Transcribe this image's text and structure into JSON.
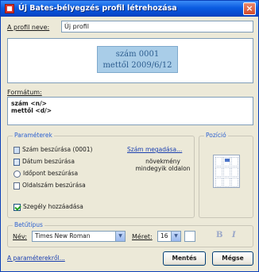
{
  "window": {
    "title": "Új Bates-bélyegzés profil létrehozása",
    "close_glyph": "×"
  },
  "profile": {
    "name_label": "A profil neve:",
    "name_value": "Új profil"
  },
  "preview": {
    "line1": "szám 0001",
    "line2": "mettől 2009/6/12",
    "color": "#a9cde8"
  },
  "format": {
    "label": "Formátum:",
    "lines": [
      "szám <n/>",
      "mettől <d/>"
    ]
  },
  "parameters": {
    "title": "Paraméterek",
    "items": [
      {
        "label": "Szám beszúrása (0001)",
        "icon": "number-icon"
      },
      {
        "label": "Dátum beszúrása",
        "icon": "calendar-icon"
      },
      {
        "label": "Időpont beszúrása",
        "icon": "clock-icon"
      },
      {
        "label": "Oldalszám beszúrása",
        "icon": "page-icon"
      }
    ],
    "number_spec_link": "Szám megadása...",
    "increment_note": [
      "növekmény",
      "mindegyik oldalon"
    ],
    "border_checkbox": {
      "label": "Szegély hozzáadása",
      "checked": true
    }
  },
  "position": {
    "title": "Pozíció"
  },
  "font": {
    "title": "Betűtípus",
    "name_label": "Név:",
    "name_value": "Times New Roman",
    "size_label": "Méret:",
    "size_value": "16",
    "bold_glyph": "B",
    "italic_glyph": "I"
  },
  "footer": {
    "about_link": "A paraméterekről...",
    "save_button": "Mentés",
    "cancel_button": "Mégse"
  },
  "colors": {
    "title_bar": "#0a5be0",
    "link": "#1a3fb0",
    "group_title": "#2a5fd0"
  }
}
